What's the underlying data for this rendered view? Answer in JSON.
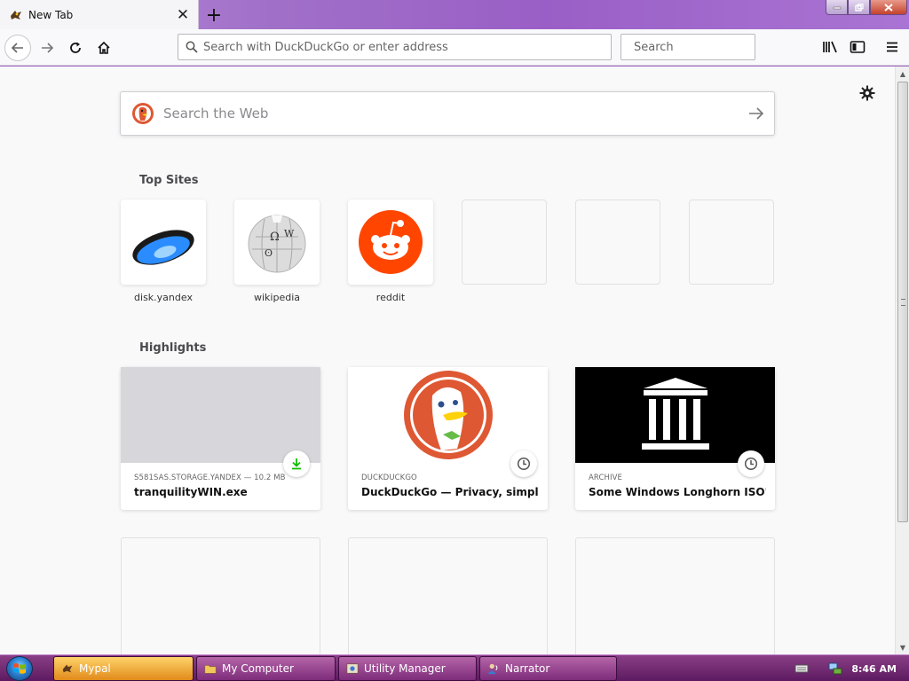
{
  "window": {
    "tab_title": "New Tab",
    "tab_close_glyph": "✕",
    "new_tab_glyph": "+"
  },
  "toolbar": {
    "url_placeholder": "Search with DuckDuckGo or enter address",
    "search_placeholder": "Search"
  },
  "page": {
    "websearch_placeholder": "Search the Web",
    "top_sites_title": "Top Sites",
    "highlights_title": "Highlights",
    "top_sites": [
      {
        "label": "disk.yandex",
        "icon": "yandex-disk-icon"
      },
      {
        "label": "wikipedia",
        "icon": "wikipedia-globe-icon"
      },
      {
        "label": "reddit",
        "icon": "reddit-icon"
      },
      {
        "label": "",
        "icon": ""
      },
      {
        "label": "",
        "icon": ""
      },
      {
        "label": "",
        "icon": ""
      }
    ],
    "highlights": [
      {
        "context": "S581SAS.STORAGE.YANDEX — 10.2 MB",
        "title": "tranquilityWIN.exe",
        "badge": "download-icon"
      },
      {
        "context": "DUCKDUCKGO",
        "title": "DuckDuckGo — Privacy, simplifi...",
        "badge": "clock-icon"
      },
      {
        "context": "ARCHIVE",
        "title": "Some Windows Longhorn ISO's :...",
        "badge": "clock-icon"
      }
    ]
  },
  "taskbar": {
    "items": [
      {
        "label": "Mypal",
        "active": true
      },
      {
        "label": "My Computer",
        "active": false
      },
      {
        "label": "Utility Manager",
        "active": false
      },
      {
        "label": "Narrator",
        "active": false
      }
    ],
    "clock": "8:46 AM"
  },
  "colors": {
    "accent_purple": "#9a5fc6",
    "reddit_orange": "#ff4500",
    "duckduckgo_orange": "#de5833",
    "download_green": "#12bc00"
  }
}
